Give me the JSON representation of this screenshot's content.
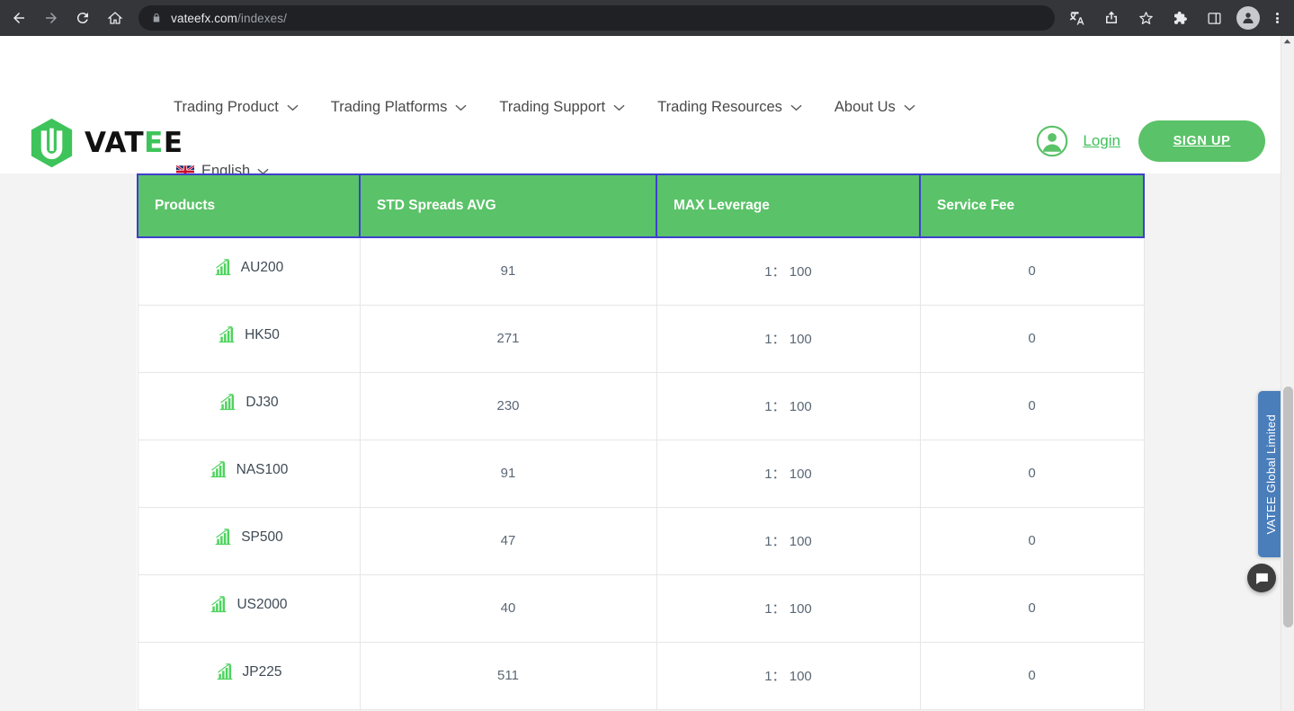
{
  "browser": {
    "back_icon": "back-arrow-icon",
    "forward_icon": "forward-arrow-icon",
    "reload_icon": "reload-icon",
    "home_icon": "home-icon",
    "lock_icon": "lock-icon",
    "url_domain": "vateefx.com",
    "url_path": "/indexes/",
    "toolbar_icons": [
      "translate-icon",
      "share-icon",
      "bookmark-star-icon",
      "extensions-puzzle-icon",
      "side-panel-icon",
      "profile-avatar-icon",
      "three-dot-menu-icon"
    ]
  },
  "site": {
    "logo_text_main": "VAT",
    "logo_text_euro": "E",
    "logo_text_tail": "E",
    "nav": [
      {
        "label": "Trading Product"
      },
      {
        "label": "Trading Platforms"
      },
      {
        "label": "Trading Support"
      },
      {
        "label": "Trading Resources"
      },
      {
        "label": "About Us"
      }
    ],
    "language": {
      "label": "English",
      "flag": "uk-flag-icon"
    },
    "login_label": "Login",
    "signup_label": "SIGN UP",
    "accent_green": "#5ac268",
    "link_green": "#3fbf5a"
  },
  "table": {
    "headers": [
      "Products",
      "STD Spreads AVG",
      "MAX Leverage",
      "Service Fee"
    ],
    "header_bg": "#5ac268",
    "header_border": "#3f3fce",
    "rows": [
      {
        "product": "AU200",
        "spread": "91",
        "leverage": "1： 100",
        "fee": "0"
      },
      {
        "product": "HK50",
        "spread": "271",
        "leverage": "1： 100",
        "fee": "0"
      },
      {
        "product": "DJ30",
        "spread": "230",
        "leverage": "1： 100",
        "fee": "0"
      },
      {
        "product": "NAS100",
        "spread": "91",
        "leverage": "1： 100",
        "fee": "0"
      },
      {
        "product": "SP500",
        "spread": "47",
        "leverage": "1： 100",
        "fee": "0"
      },
      {
        "product": "US2000",
        "spread": "40",
        "leverage": "1： 100",
        "fee": "0"
      },
      {
        "product": "JP225",
        "spread": "511",
        "leverage": "1： 100",
        "fee": "0"
      }
    ]
  },
  "widgets": {
    "side_tab_label": "VATEE Global Limited",
    "side_tab_color": "#4a7ebb",
    "chat_icon": "chat-bubble-icon"
  }
}
